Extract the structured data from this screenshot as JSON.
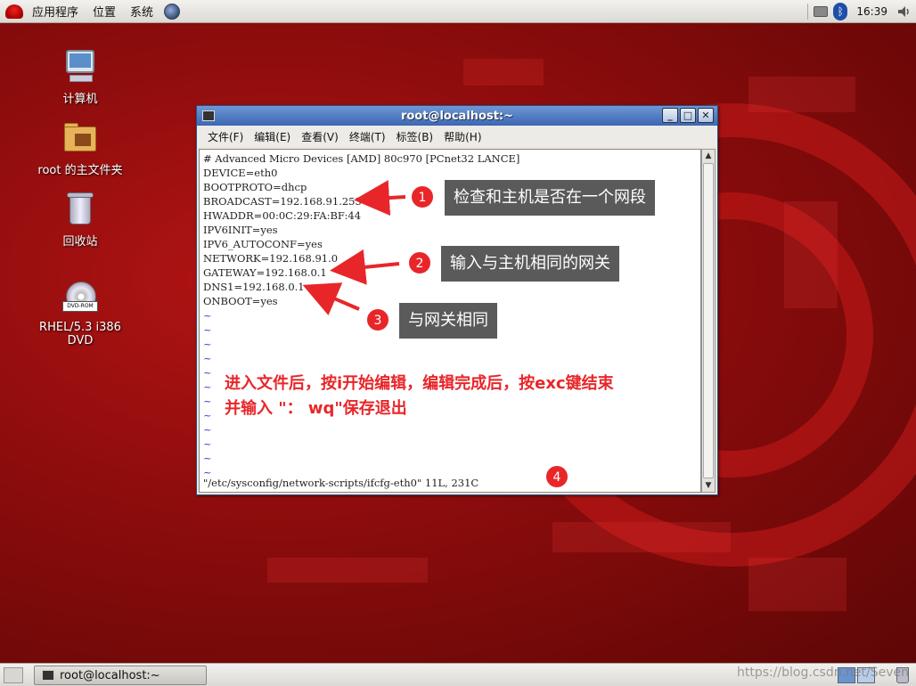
{
  "top_panel": {
    "menus": [
      "应用程序",
      "位置",
      "系统"
    ],
    "clock": "16:39"
  },
  "desktop_icons": [
    {
      "label": "计算机",
      "icon": "computer-icon"
    },
    {
      "label": "root 的主文件夹",
      "icon": "home-folder-icon"
    },
    {
      "label": "回收站",
      "icon": "trash-icon"
    },
    {
      "label": "RHEL/5.3 i386 DVD",
      "icon": "dvd-icon",
      "disc_label": "DVD-ROM"
    }
  ],
  "terminal": {
    "title": "root@localhost:~",
    "menus": [
      "文件(F)",
      "编辑(E)",
      "查看(V)",
      "终端(T)",
      "标签(B)",
      "帮助(H)"
    ],
    "lines": [
      "# Advanced Micro Devices [AMD] 80c970 [PCnet32 LANCE]",
      "DEVICE=eth0",
      "BOOTPROTO=dhcp",
      "BROADCAST=192.168.91.255",
      "HWADDR=00:0C:29:FA:BF:44",
      "IPV6INIT=yes",
      "IPV6_AUTOCONF=yes",
      "NETWORK=192.168.91.0",
      "GATEWAY=192.168.0.1",
      "DNS1=192.168.0.1",
      "ONBOOT=yes"
    ],
    "tilde": "~",
    "tilde_count": 12,
    "status_line": "\"/etc/sysconfig/network-scripts/ifcfg-eth0\" 11L, 231C"
  },
  "annotations": {
    "badges": [
      "1",
      "2",
      "3",
      "4"
    ],
    "callouts": [
      "检查和主机是否在一个网段",
      "输入与主机相同的网关",
      "与网关相同"
    ],
    "note_line1": "进入文件后，按i开始编辑，编辑完成后，按exc键结束",
    "note_line2": "并输入 \"：  wq\"保存退出",
    "color": "#e8262a"
  },
  "bottom_panel": {
    "task_label": "root@localhost:~",
    "watermark": "https://blog.csdn.net/Seven"
  }
}
